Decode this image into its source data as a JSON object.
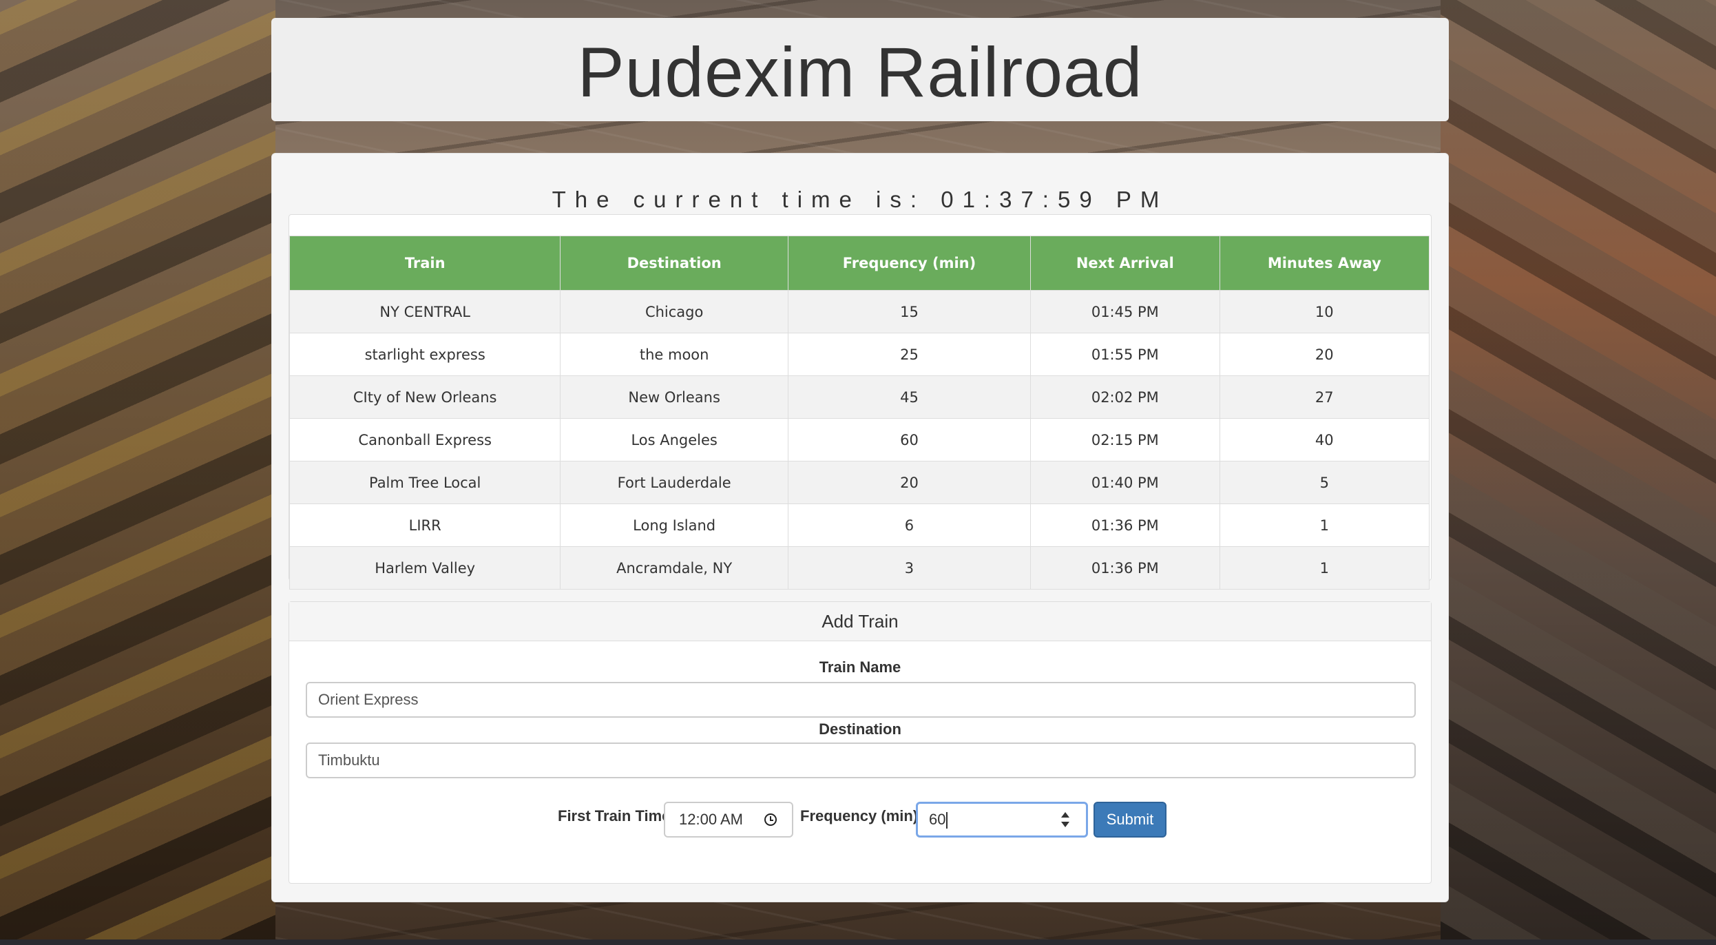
{
  "header": {
    "title": "Pudexim Railroad"
  },
  "clock": {
    "text": "The current time is: 01:37:59 PM"
  },
  "schedule": {
    "columns": [
      "Train",
      "Destination",
      "Frequency (min)",
      "Next Arrival",
      "Minutes Away"
    ],
    "rows": [
      [
        "NY CENTRAL",
        "Chicago",
        "15",
        "01:45 PM",
        "10"
      ],
      [
        "starlight express",
        "the moon",
        "25",
        "01:55 PM",
        "20"
      ],
      [
        "CIty of New Orleans",
        "New Orleans",
        "45",
        "02:02 PM",
        "27"
      ],
      [
        "Canonball Express",
        "Los Angeles",
        "60",
        "02:15 PM",
        "40"
      ],
      [
        "Palm Tree Local",
        "Fort Lauderdale",
        "20",
        "01:40 PM",
        "5"
      ],
      [
        "LIRR",
        "Long Island",
        "6",
        "01:36 PM",
        "1"
      ],
      [
        "Harlem Valley",
        "Ancramdale, NY",
        "3",
        "01:36 PM",
        "1"
      ]
    ]
  },
  "add_form": {
    "heading": "Add Train",
    "train_name_label": "Train Name",
    "train_name_value": "Orient Express",
    "destination_label": "Destination",
    "destination_value": "Timbuktu",
    "first_time_label": "First Train Time",
    "first_time_value": "12:00 AM",
    "frequency_label": "Frequency (min)",
    "frequency_value": "60",
    "submit_label": "Submit"
  },
  "colors": {
    "table_header": "#6aac5c",
    "submit_button": "#3c7ab8",
    "focus_ring": "#7aa7e8"
  },
  "icons": {
    "time_field": "clock-icon",
    "number_field": "spinner-icon"
  }
}
